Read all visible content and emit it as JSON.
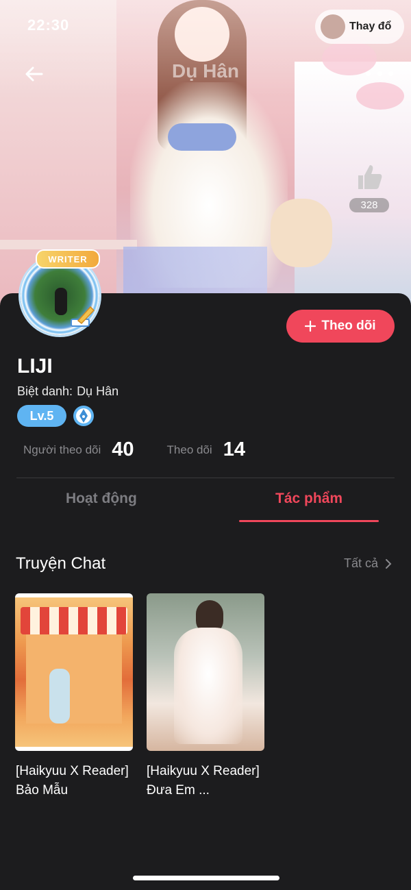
{
  "status_bar": {
    "time": "22:30",
    "pill_text": "Thay đổ"
  },
  "header": {
    "title": "Dụ Hân"
  },
  "likes": {
    "count": "328"
  },
  "profile": {
    "badge": "WRITER",
    "name": "LIJI",
    "nickname_label": "Biệt danh:",
    "nickname_value": "Dụ Hân",
    "level": "Lv.5",
    "follow_button": "Theo dõi"
  },
  "stats": {
    "followers_label": "Người theo dõi",
    "followers_value": "40",
    "following_label": "Theo dõi",
    "following_value": "14"
  },
  "tabs": [
    {
      "label": "Hoạt động",
      "active": false
    },
    {
      "label": "Tác phẩm",
      "active": true
    }
  ],
  "section": {
    "title": "Truyện Chat",
    "see_all": "Tất cả"
  },
  "books": [
    {
      "title": "[Haikyuu X Reader] Bảo Mẫu"
    },
    {
      "title": "[Haikyuu X Reader] Đưa Em ..."
    }
  ],
  "colors": {
    "accent": "#f0475b",
    "level": "#5fb4f2",
    "background": "#1c1c1e"
  }
}
